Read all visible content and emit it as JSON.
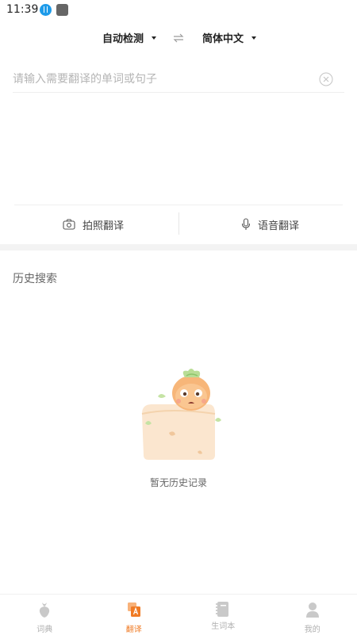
{
  "status_bar": {
    "time": "11:39"
  },
  "language_bar": {
    "source": "自动检测",
    "target": "简体中文"
  },
  "input": {
    "placeholder": "请输入需要翻译的单词或句子",
    "value": ""
  },
  "actions": {
    "photo": "拍照翻译",
    "voice": "语音翻译"
  },
  "history": {
    "title": "历史搜索",
    "empty": "暂无历史记录"
  },
  "tab_bar": {
    "active": "翻译",
    "accent_color": "#f07b25",
    "items": [
      {
        "label": "词典",
        "icon": "radish-icon"
      },
      {
        "label": "翻译",
        "icon": "translate-icon"
      },
      {
        "label": "生词本",
        "icon": "notebook-icon"
      },
      {
        "label": "我的",
        "icon": "person-icon"
      }
    ]
  }
}
